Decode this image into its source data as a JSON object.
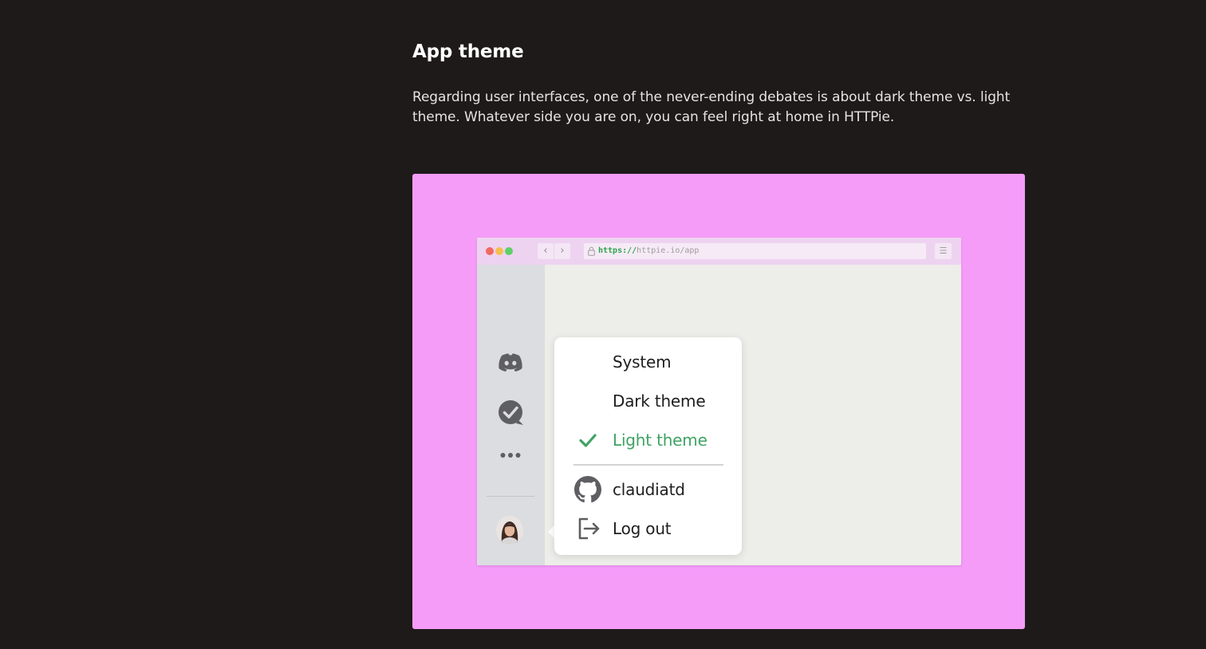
{
  "section": {
    "title": "App theme",
    "description": "Regarding user interfaces, one of the never-ending debates is about dark theme vs. light theme. Whatever side you are on, you can feel right at home in HTTPie."
  },
  "colors": {
    "page_background": "#1e1a1a",
    "showcase_background": "#f59cf9",
    "accent_green": "#3fa364"
  },
  "browser": {
    "nav": {
      "back_glyph": "‹",
      "forward_glyph": "›",
      "menu_glyph": "☰"
    },
    "url": {
      "scheme": "https://",
      "rest": "httpie.io/app"
    }
  },
  "sidebar": {
    "icons": [
      "discord-icon",
      "check-bubble-icon",
      "more-icon"
    ],
    "avatar": "user-avatar"
  },
  "theme_menu": {
    "items": [
      {
        "label": "System",
        "selected": false
      },
      {
        "label": "Dark theme",
        "selected": false
      },
      {
        "label": "Light theme",
        "selected": true
      }
    ],
    "account": {
      "username": "claudiatd",
      "logout_label": "Log out"
    }
  }
}
